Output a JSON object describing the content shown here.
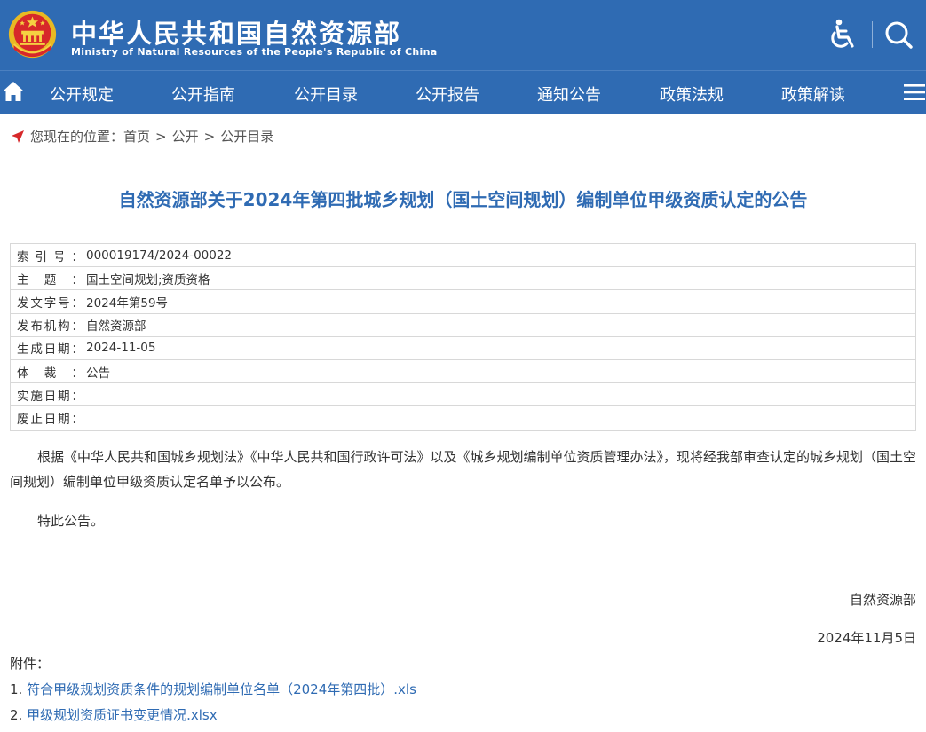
{
  "header": {
    "title_cn": "中华人民共和国自然资源部",
    "title_en": "Ministry of Natural Resources of the People's Republic of China",
    "brand_color": "#2f6bb3",
    "icons": [
      "national-emblem-icon",
      "accessibility-icon",
      "search-icon"
    ]
  },
  "nav": {
    "items": [
      {
        "label": "公开规定"
      },
      {
        "label": "公开指南"
      },
      {
        "label": "公开目录"
      },
      {
        "label": "公开报告"
      },
      {
        "label": "通知公告"
      },
      {
        "label": "政策法规"
      },
      {
        "label": "政策解读"
      }
    ],
    "icons": [
      "home-icon",
      "menu-icon"
    ]
  },
  "breadcrumb": {
    "prefix": "您现在的位置：",
    "items": [
      "首页",
      "公开",
      "公开目录"
    ],
    "separator": ">"
  },
  "article": {
    "title": "自然资源部关于2024年第四批城乡规划（国土空间规划）编制单位甲级资质认定的公告",
    "meta": [
      {
        "key": "索引号：",
        "value": "000019174/2024-00022"
      },
      {
        "key": "主题：",
        "value": "国土空间规划;资质资格"
      },
      {
        "key": "发文字号：",
        "value": "2024年第59号"
      },
      {
        "key": "发布机构：",
        "value": "自然资源部"
      },
      {
        "key": "生成日期：",
        "value": "2024-11-05"
      },
      {
        "key": "体裁：",
        "value": "公告"
      },
      {
        "key": "实施日期：",
        "value": ""
      },
      {
        "key": "废止日期：",
        "value": ""
      }
    ],
    "paragraphs": [
      "根据《中华人民共和国城乡规划法》《中华人民共和国行政许可法》以及《城乡规划编制单位资质管理办法》，现将经我部审查认定的城乡规划（国土空间规划）编制单位甲级资质认定名单予以公布。",
      "特此公告。"
    ],
    "signature": "自然资源部",
    "date": "2024年11月5日",
    "attachments_label": "附件：",
    "attachments": [
      {
        "num": "1. ",
        "label": "符合甲级规划资质条件的规划编制单位名单（2024年第四批）.xls"
      },
      {
        "num": "2. ",
        "label": "甲级规划资质证书变更情况.xlsx"
      }
    ]
  }
}
